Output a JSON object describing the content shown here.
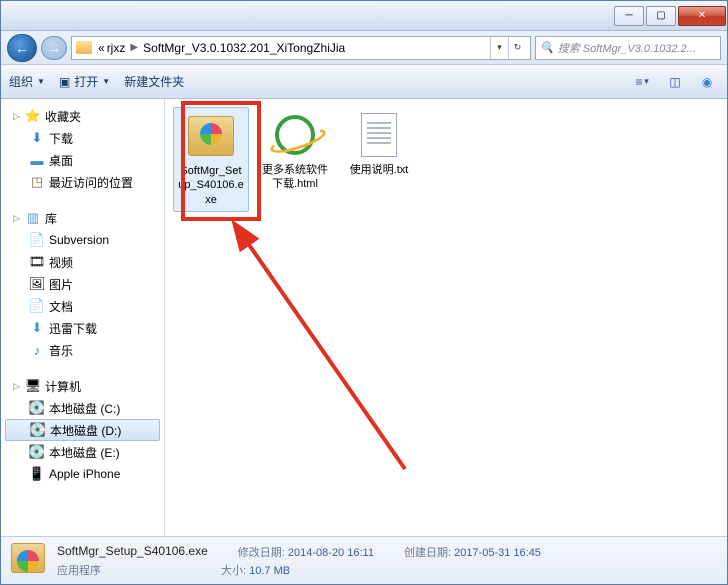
{
  "path": {
    "seg1": "rjxz",
    "seg2": "SoftMgr_V3.0.1032.201_XiTongZhiJia"
  },
  "search": {
    "placeholder": "搜索 SoftMgr_V3.0.1032.2..."
  },
  "toolbar": {
    "organize": "组织",
    "open": "打开",
    "newfolder": "新建文件夹"
  },
  "sidebar": {
    "favorites": "收藏夹",
    "downloads": "下载",
    "desktop": "桌面",
    "recent": "最近访问的位置",
    "libraries": "库",
    "subversion": "Subversion",
    "videos": "视频",
    "pictures": "图片",
    "documents": "文档",
    "xunlei": "迅雷下载",
    "music": "音乐",
    "computer": "计算机",
    "drive_c": "本地磁盘 (C:)",
    "drive_d": "本地磁盘 (D:)",
    "drive_e": "本地磁盘 (E:)",
    "iphone": "Apple iPhone"
  },
  "files": {
    "f1": "SoftMgr_Setup_S40106.exe",
    "f2": "更多系统软件下载.html",
    "f3": "使用说明.txt"
  },
  "status": {
    "name": "SoftMgr_Setup_S40106.exe",
    "type": "应用程序",
    "mod_label": "修改日期:",
    "mod_val": "2014-08-20 16:11",
    "size_label": "大小:",
    "size_val": "10.7 MB",
    "created_label": "创建日期:",
    "created_val": "2017-05-31 16:45"
  }
}
